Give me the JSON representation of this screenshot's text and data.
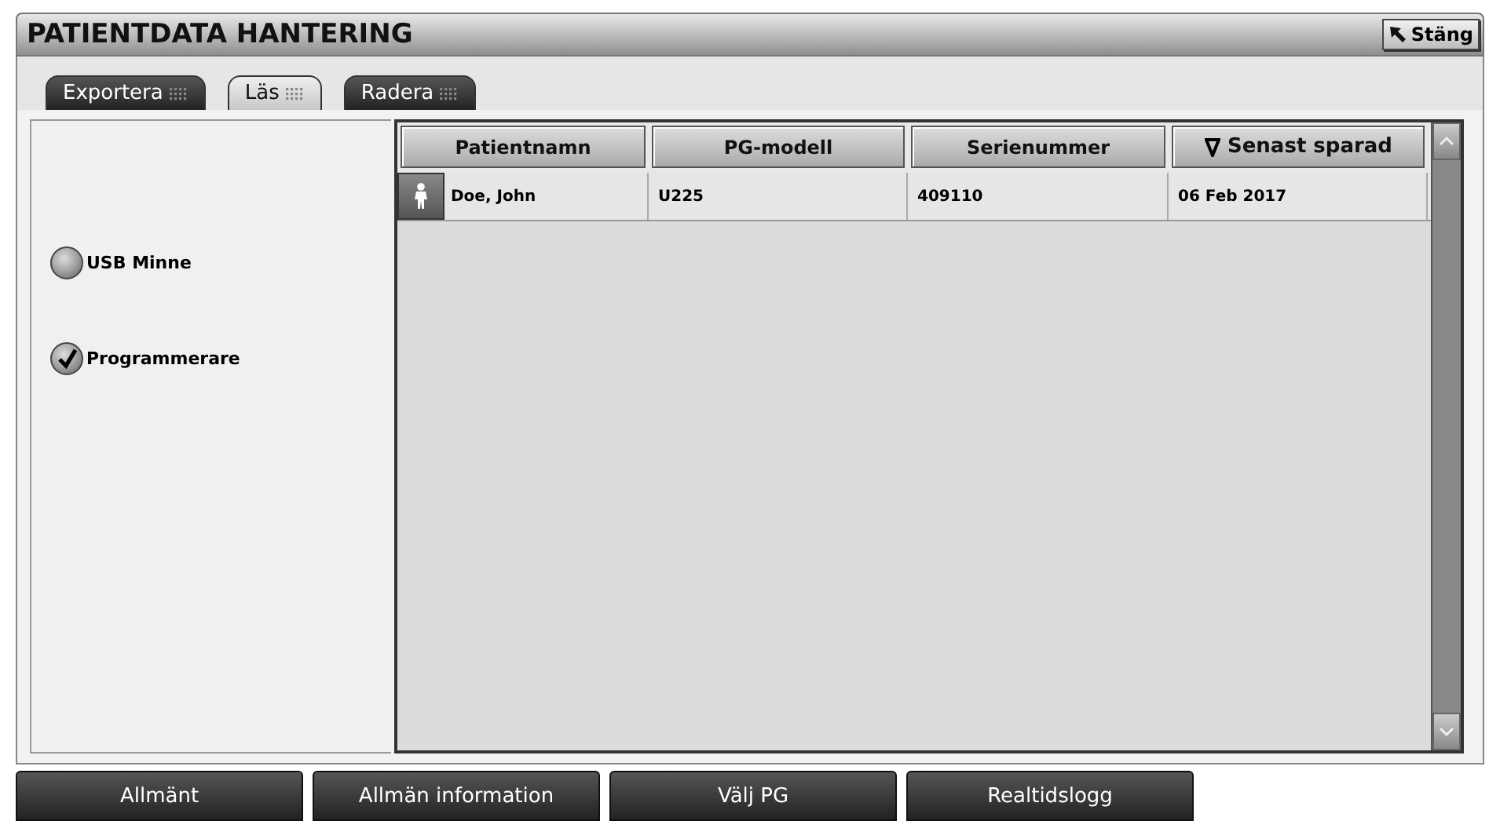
{
  "window": {
    "title": "PATIENTDATA HANTERING",
    "close_button": "Stäng"
  },
  "tabs": [
    {
      "label": "Exportera",
      "selected": false
    },
    {
      "label": "Läs",
      "selected": true
    },
    {
      "label": "Radera",
      "selected": false
    }
  ],
  "sources": [
    {
      "label": "USB Minne",
      "selected": false
    },
    {
      "label": "Programmerare",
      "selected": true
    }
  ],
  "table": {
    "columns": [
      {
        "label": "Patientnamn",
        "sorted": false
      },
      {
        "label": "PG-modell",
        "sorted": false
      },
      {
        "label": "Serienummer",
        "sorted": false
      },
      {
        "label": "Senast sparad",
        "sorted": true
      }
    ],
    "rows": [
      {
        "cells": [
          "Doe, John",
          "U225",
          "409110",
          "06 Feb 2017"
        ],
        "selected": false
      }
    ]
  },
  "bottom_buttons": [
    "Allmänt",
    "Allmän information",
    "Välj PG",
    "Realtidslogg"
  ]
}
